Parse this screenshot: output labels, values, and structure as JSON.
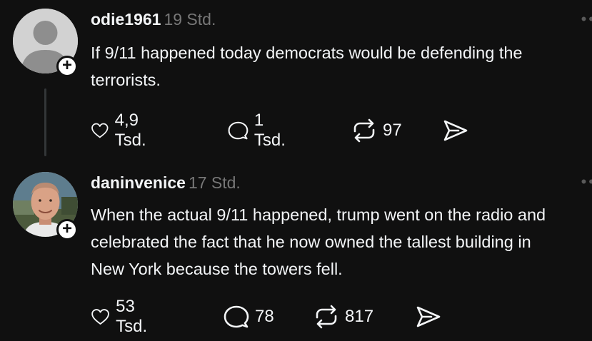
{
  "posts": [
    {
      "username": "odie1961",
      "time": "19 Std.",
      "text": "If 9/11 happened today democrats would be defending the\nterrorists.",
      "likes": "4,9 Tsd.",
      "replies": "1 Tsd.",
      "reposts": "97",
      "avatar": "default-avatar-icon"
    },
    {
      "username": "daninvenice",
      "time": "17 Std.",
      "text": "When the actual 9/11 happened, trump went on the radio and\ncelebrated the fact that he now owned the tallest building in\nNew York because the towers fell.",
      "likes": "53 Tsd.",
      "replies": "78",
      "reposts": "817",
      "avatar": "profile-photo"
    }
  ],
  "icons": {
    "like": "heart-icon",
    "reply": "speech-bubble-icon",
    "repost": "repost-icon",
    "share": "send-icon",
    "follow": "plus-icon",
    "more": "more-dots-icon"
  },
  "colors": {
    "background": "#101010",
    "text": "#f3f5f7",
    "muted": "#777777"
  }
}
